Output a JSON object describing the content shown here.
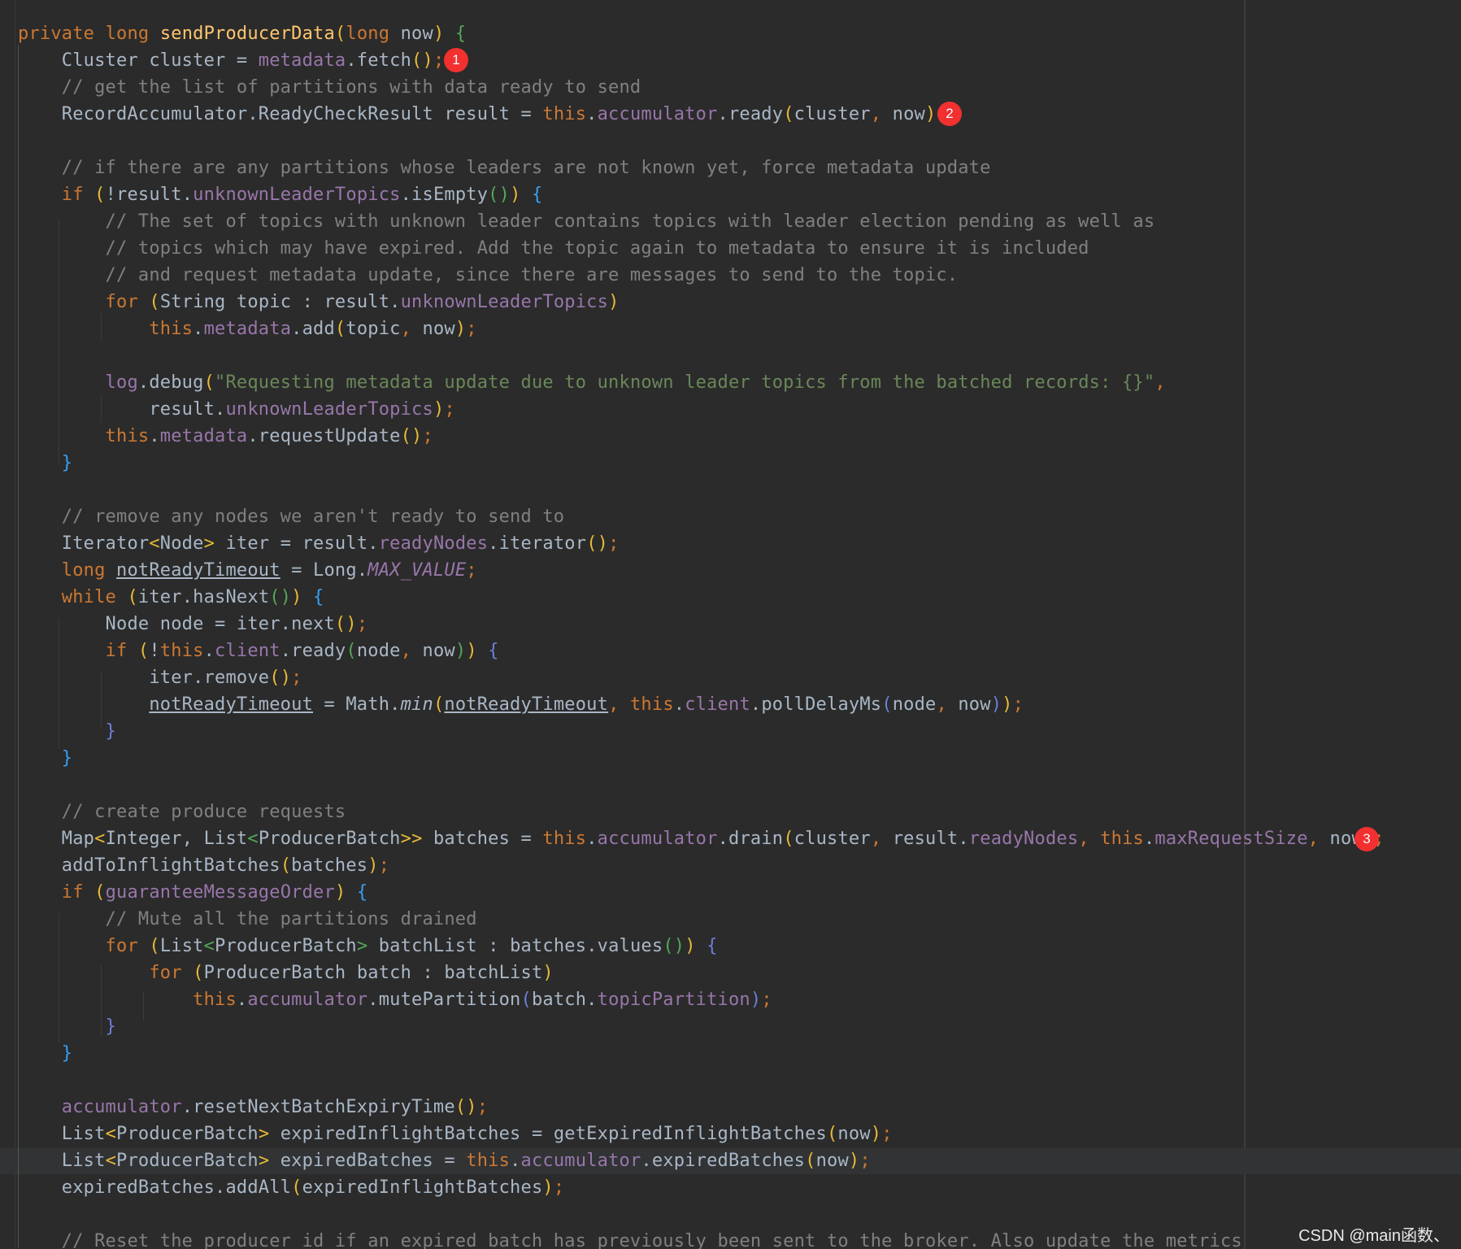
{
  "watermark": "CSDN @main函数、",
  "markers": [
    "1",
    "2",
    "3"
  ],
  "colors": {
    "background": "#2b2b2b",
    "keyword": "#cc7832",
    "method": "#ffc66d",
    "field": "#9876aa",
    "comment": "#808080",
    "string": "#6a8759",
    "plain": "#a9b7c6",
    "marker": "#f23030"
  },
  "code": {
    "l1": {
      "kw_private": "private",
      "kw_long": "long",
      "fn_name": "sendProducerData",
      "p_open": "(",
      "kw_long2": "long",
      "param": " now",
      "p_close": ")",
      "brace": " {"
    },
    "l2": {
      "a": "    Cluster cluster = ",
      "fld": "metadata",
      "b": ".fetch",
      "p1": "(",
      "p2": ")",
      "semi": ";"
    },
    "l3": {
      "cm": "    // get the list of partitions with data ready to send"
    },
    "l4": {
      "a": "    RecordAccumulator.ReadyCheckResult result = ",
      "kw_this": "this",
      "dot": ".",
      "fld": "accumulator",
      "b": ".ready",
      "p1": "(",
      "args1": "cluster",
      "comma": ",",
      "args2": " now",
      "p2": ")",
      "semi": ";"
    },
    "l6": {
      "cm": "    // if there are any partitions whose leaders are not known yet, force metadata update"
    },
    "l7": {
      "kw": "    if",
      "sp": " ",
      "p1": "(",
      "a": "!result.",
      "fld": "unknownLeaderTopics",
      "b": ".isEmpty",
      "p2": "()",
      "p3": ")",
      "brace": " {"
    },
    "l8": {
      "cm": "        // The set of topics with unknown leader contains topics with leader election pending as well as"
    },
    "l9": {
      "cm": "        // topics which may have expired. Add the topic again to metadata to ensure it is included"
    },
    "l10": {
      "cm": "        // and request metadata update, since there are messages to send to the topic."
    },
    "l11": {
      "kw": "        for",
      "sp": " ",
      "p1": "(",
      "a": "String topic : result.",
      "fld": "unknownLeaderTopics",
      "p2": ")"
    },
    "l12": {
      "kw_this": "            this",
      "dot": ".",
      "fld": "metadata",
      "b": ".add",
      "p1": "(",
      "a1": "topic",
      "comma": ",",
      "a2": " now",
      "p2": ")",
      "semi": ";"
    },
    "l14": {
      "fld": "        log",
      "b": ".debug",
      "p1": "(",
      "str": "\"Requesting metadata update due to unknown leader topics from the batched records: {}\"",
      "comma": ","
    },
    "l15": {
      "a": "            result.",
      "fld": "unknownLeaderTopics",
      "p2": ")",
      "semi": ";"
    },
    "l16": {
      "kw_this": "        this",
      "dot": ".",
      "fld": "metadata",
      "b": ".requestUpdate",
      "p1": "()",
      "semi": ";"
    },
    "l17": {
      "brace": "    }"
    },
    "l19": {
      "cm": "    // remove any nodes we aren't ready to send to"
    },
    "l20": {
      "a": "    Iterator",
      "lt": "<",
      "t": "Node",
      "gt": ">",
      "b": " iter = result.",
      "fld": "readyNodes",
      "c": ".iterator",
      "p1": "()",
      "semi": ";"
    },
    "l21": {
      "kw": "    long",
      "sp": " ",
      "var": "notReadyTimeout",
      "a": " = Long.",
      "cst": "MAX_VALUE",
      "semi": ";"
    },
    "l22": {
      "kw": "    while",
      "sp": " ",
      "p1": "(",
      "a": "iter.hasNext",
      "p2": "()",
      "p3": ")",
      "brace": " {"
    },
    "l23": {
      "a": "        Node node = iter.next",
      "p1": "()",
      "semi": ";"
    },
    "l24": {
      "kw": "        if",
      "sp": " ",
      "p1": "(",
      "a": "!",
      "kw_this": "this",
      "dot": ".",
      "fld": "client",
      "b": ".ready",
      "p2": "(",
      "a1": "node",
      "comma": ",",
      "a2": " now",
      "p3": ")",
      "p4": ")",
      "brace": " {"
    },
    "l25": {
      "a": "            iter.remove",
      "p1": "()",
      "semi": ";"
    },
    "l26": {
      "sp": "            ",
      "var": "notReadyTimeout",
      "a": " = Math.",
      "st": "min",
      "p1": "(",
      "var2": "notReadyTimeout",
      "comma": ",",
      "sp2": " ",
      "kw_this": "this",
      "dot": ".",
      "fld": "client",
      "b": ".pollDelayMs",
      "p2": "(",
      "a1": "node",
      "comma2": ",",
      "a2": " now",
      "p3": ")",
      "p4": ")",
      "semi": ";"
    },
    "l27": {
      "brace": "        }"
    },
    "l28": {
      "brace": "    }"
    },
    "l30": {
      "cm": "    // create produce requests"
    },
    "l31": {
      "a": "    Map",
      "lt": "<",
      "t": "Integer, List",
      "lt2": "<",
      "t2": "ProducerBatch",
      "gt": ">>",
      "b": " batches = ",
      "kw_this": "this",
      "dot": ".",
      "fld": "accumulator",
      "c": ".drain",
      "p1": "(",
      "a1": "cluster",
      "comma": ",",
      "a2": " result.",
      "fld2": "readyNodes",
      "comma2": ",",
      "sp": " ",
      "kw_this2": "this",
      "dot2": ".",
      "fld3": "maxRequestSize",
      "comma3": ",",
      "a3": " now",
      "p2": ")",
      "semi": ";"
    },
    "l32": {
      "a": "    addToInflightBatches",
      "p1": "(",
      "a1": "batches",
      "p2": ")",
      "semi": ";"
    },
    "l33": {
      "kw": "    if",
      "sp": " ",
      "p1": "(",
      "fld": "guaranteeMessageOrder",
      "p2": ")",
      "brace": " {"
    },
    "l34": {
      "cm": "        // Mute all the partitions drained"
    },
    "l35": {
      "kw": "        for",
      "sp": " ",
      "p1": "(",
      "a": "List",
      "lt": "<",
      "t": "ProducerBatch",
      "gt": ">",
      "b": " batchList : batches.values",
      "p2": "()",
      "p3": ")",
      "brace": " {"
    },
    "l36": {
      "kw": "            for",
      "sp": " ",
      "p1": "(",
      "a": "ProducerBatch batch : batchList",
      "p2": ")"
    },
    "l37": {
      "kw_this": "                this",
      "dot": ".",
      "fld": "accumulator",
      "b": ".mutePartition",
      "p1": "(",
      "a": "batch.",
      "fld2": "topicPartition",
      "p2": ")",
      "semi": ";"
    },
    "l38": {
      "brace": "        }"
    },
    "l39": {
      "brace": "    }"
    },
    "l41": {
      "fld": "    accumulator",
      "b": ".resetNextBatchExpiryTime",
      "p1": "()",
      "semi": ";"
    },
    "l42": {
      "a": "    List",
      "lt": "<",
      "t": "ProducerBatch",
      "gt": ">",
      "b": " expiredInflightBatches = getExpiredInflightBatches",
      "p1": "(",
      "a1": "now",
      "p2": ")",
      "semi": ";"
    },
    "l43": {
      "a": "    List",
      "lt": "<",
      "t": "ProducerBatch",
      "gt": ">",
      "b": " expiredBatches = ",
      "kw_this": "this",
      "dot": ".",
      "fld": "accumulator",
      "c": ".expiredBatches",
      "p1": "(",
      "a1": "now",
      "p2": ")",
      "semi": ";"
    },
    "l44": {
      "a": "    expiredBatches.addAll",
      "p1": "(",
      "a1": "expiredInflightBatches",
      "p2": ")",
      "semi": ";"
    },
    "l46": {
      "cm": "    // Reset the producer id if an expired batch has previously been sent to the broker. Also update the metrics"
    }
  }
}
